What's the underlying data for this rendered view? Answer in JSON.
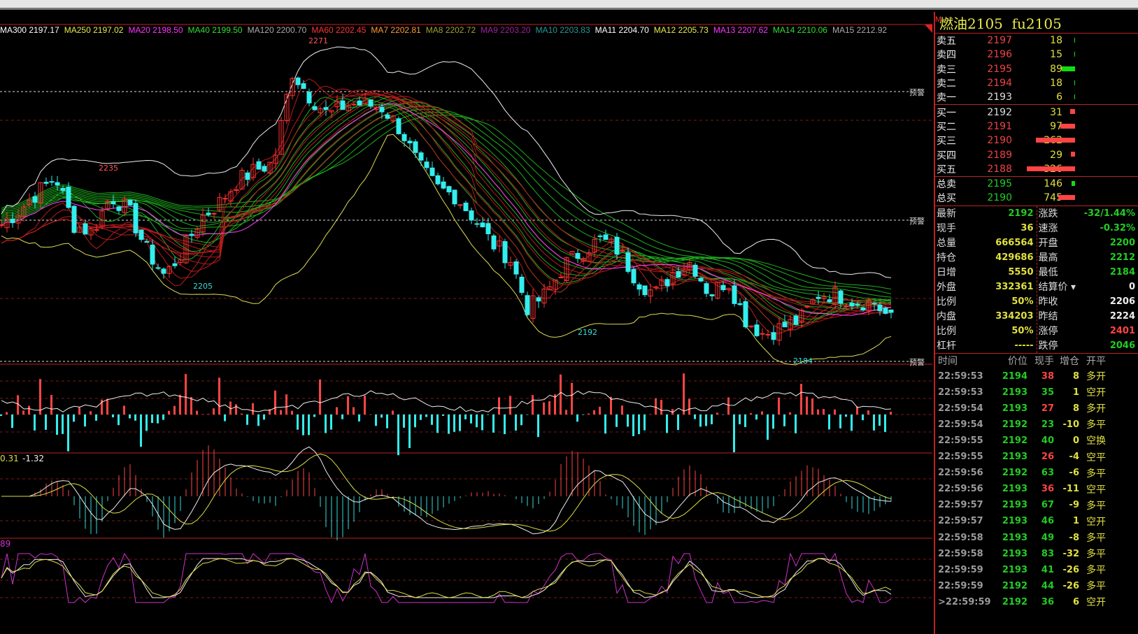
{
  "ma_legend": [
    {
      "label": "MA300 2197.17",
      "color": "#ffffff"
    },
    {
      "label": "MA250 2197.02",
      "color": "#e8e84a"
    },
    {
      "label": "MA20 2198.50",
      "color": "#ff33ff"
    },
    {
      "label": "MA40 2199.50",
      "color": "#33dd33"
    },
    {
      "label": "MA120 2200.70",
      "color": "#aaaaaa"
    },
    {
      "label": "MA60 2202.45",
      "color": "#ff3333"
    },
    {
      "label": "MA7 2202.81",
      "color": "#ff9933"
    },
    {
      "label": "MA8 2202.72",
      "color": "#a0a030"
    },
    {
      "label": "MA9 2203.20",
      "color": "#a020a0"
    },
    {
      "label": "MA10 2203.83",
      "color": "#229999"
    },
    {
      "label": "MA11 2204.70",
      "color": "#ffffff"
    },
    {
      "label": "MA12 2205.73",
      "color": "#e8e84a"
    },
    {
      "label": "MA13 2207.62",
      "color": "#ff33ff"
    },
    {
      "label": "MA14 2210.06",
      "color": "#33dd33"
    },
    {
      "label": "MA15 2212.92",
      "color": "#aaaaaa"
    }
  ],
  "warn_label": "预警",
  "macd_values": [
    "0.31",
    "-1.32"
  ],
  "kdj_value": "89",
  "price_labels": [
    "2271",
    "2235",
    "2205",
    "2192",
    "2184"
  ],
  "chart_data": {
    "type": "candlestick",
    "price_range": [
      2184,
      2271
    ],
    "key_closes": [
      2221,
      2225,
      2230,
      2234,
      2221,
      2219,
      2229,
      2225,
      2214,
      2207,
      2214,
      2223,
      2227,
      2233,
      2236,
      2238,
      2263,
      2256,
      2251,
      2254,
      2254,
      2253,
      2247,
      2237,
      2231,
      2229,
      2223,
      2216,
      2212,
      2198,
      2202,
      2210,
      2214,
      2217,
      2214,
      2206,
      2202,
      2208,
      2211,
      2202,
      2206,
      2195,
      2191,
      2193,
      2195,
      2202,
      2202,
      2200,
      2200,
      2195
    ]
  },
  "quote": {
    "marker": "M",
    "title": "燃油2105  fu2105",
    "asks": [
      {
        "label": "卖五",
        "price": "2197",
        "vol": "18",
        "bar": 18
      },
      {
        "label": "卖四",
        "price": "2196",
        "vol": "15",
        "bar": 15
      },
      {
        "label": "卖三",
        "price": "2195",
        "vol": "89",
        "bar": 89
      },
      {
        "label": "卖二",
        "price": "2194",
        "vol": "18",
        "bar": 18
      },
      {
        "label": "卖一",
        "price": "2193",
        "vol": "6",
        "bar": 6
      }
    ],
    "bids": [
      {
        "label": "买一",
        "price": "2192",
        "vol": "31",
        "bar": 31
      },
      {
        "label": "买二",
        "price": "2191",
        "vol": "97",
        "bar": 97
      },
      {
        "label": "买三",
        "price": "2190",
        "vol": "262",
        "bar": 262
      },
      {
        "label": "买四",
        "price": "2189",
        "vol": "29",
        "bar": 29
      },
      {
        "label": "买五",
        "price": "2188",
        "vol": "326",
        "bar": 326
      }
    ],
    "totals": [
      {
        "label": "总卖",
        "price": "2195",
        "vol": "146",
        "bar": 146
      },
      {
        "label": "总买",
        "price": "2190",
        "vol": "745",
        "bar": 745
      }
    ],
    "stats_left": [
      {
        "k": "最新",
        "v": "2192",
        "c": "green"
      },
      {
        "k": "现手",
        "v": "36",
        "c": "yellow"
      },
      {
        "k": "总量",
        "v": "666564",
        "c": "yellow"
      },
      {
        "k": "持仓",
        "v": "429686",
        "c": "yellow"
      },
      {
        "k": "日增",
        "v": "5550",
        "c": "yellow"
      },
      {
        "k": "外盘",
        "v": "332361",
        "c": "yellow"
      },
      {
        "k": "比例",
        "v": "50%",
        "c": "yellow"
      },
      {
        "k": "内盘",
        "v": "334203",
        "c": "yellow"
      },
      {
        "k": "比例",
        "v": "50%",
        "c": "yellow"
      },
      {
        "k": "杠杆",
        "v": "-----",
        "c": "yellow"
      }
    ],
    "stats_right": [
      {
        "k": "涨跌",
        "v": "-32/1.44%",
        "c": "green"
      },
      {
        "k": "速涨",
        "v": "-0.32%",
        "c": "green"
      },
      {
        "k": "开盘",
        "v": "2200",
        "c": "green"
      },
      {
        "k": "最高",
        "v": "2212",
        "c": "green"
      },
      {
        "k": "最低",
        "v": "2184",
        "c": "green"
      },
      {
        "k": "结算价 ▾",
        "v": "0",
        "c": "white"
      },
      {
        "k": "昨收",
        "v": "2206",
        "c": "white"
      },
      {
        "k": "昨结",
        "v": "2224",
        "c": "white"
      },
      {
        "k": "涨停",
        "v": "2401",
        "c": "red"
      },
      {
        "k": "跌停",
        "v": "2046",
        "c": "green"
      }
    ]
  },
  "trades": {
    "headers": [
      "时间",
      "价位",
      "现手",
      "增仓",
      "开平"
    ],
    "rows": [
      [
        "22:59:53",
        "2194",
        "38",
        "8",
        "多开",
        "red"
      ],
      [
        "22:59:53",
        "2193",
        "35",
        "1",
        "空开",
        "green"
      ],
      [
        "22:59:54",
        "2193",
        "27",
        "8",
        "多开",
        "red"
      ],
      [
        "22:59:54",
        "2192",
        "23",
        "-10",
        "多平",
        "green"
      ],
      [
        "22:59:55",
        "2192",
        "40",
        "0",
        "空换",
        "green"
      ],
      [
        "22:59:55",
        "2193",
        "26",
        "-4",
        "空平",
        "red"
      ],
      [
        "22:59:56",
        "2192",
        "63",
        "-6",
        "多平",
        "green"
      ],
      [
        "22:59:56",
        "2193",
        "36",
        "-11",
        "空平",
        "red"
      ],
      [
        "22:59:57",
        "2193",
        "67",
        "-9",
        "多平",
        "green"
      ],
      [
        "22:59:57",
        "2193",
        "46",
        "1",
        "空开",
        "green"
      ],
      [
        "22:59:58",
        "2193",
        "49",
        "-8",
        "多平",
        "green"
      ],
      [
        "22:59:58",
        "2193",
        "83",
        "-32",
        "多平",
        "green"
      ],
      [
        "22:59:59",
        "2193",
        "41",
        "-26",
        "多平",
        "green"
      ],
      [
        "22:59:59",
        "2192",
        "44",
        "-26",
        "多平",
        "green"
      ],
      [
        ">22:59:59",
        "2192",
        "36",
        "6",
        "空开",
        "green"
      ]
    ]
  }
}
